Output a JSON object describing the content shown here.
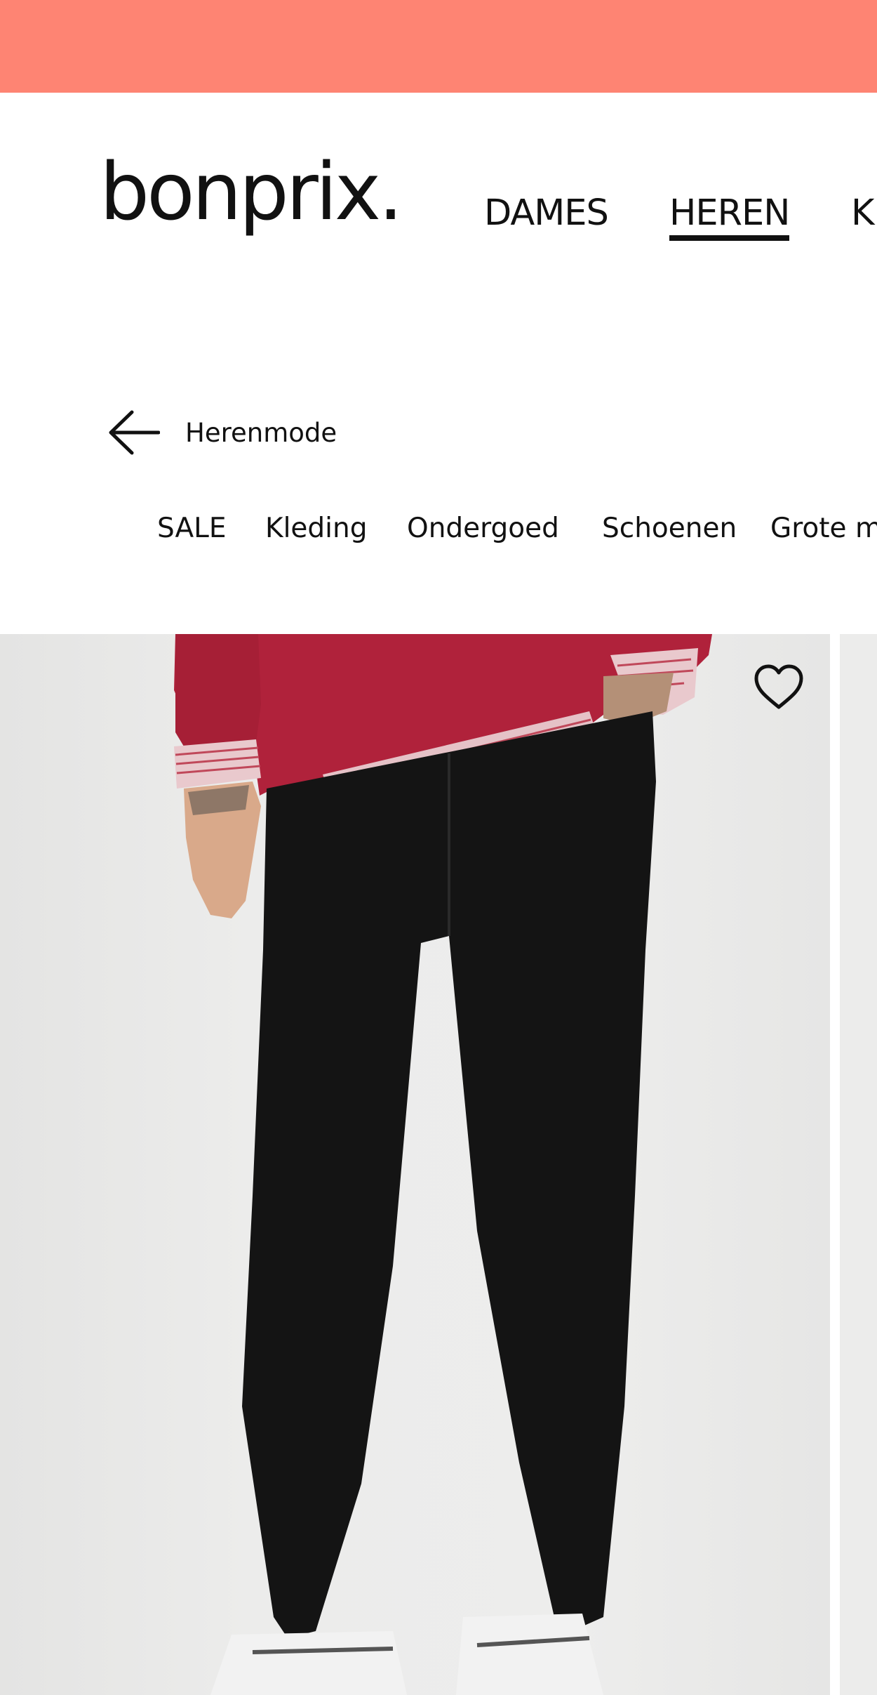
{
  "brand": {
    "logo_text": "bonprix.",
    "accent_color": "#fe8473"
  },
  "main_nav": {
    "items": [
      {
        "label": "DAMES",
        "active": false
      },
      {
        "label": "HEREN",
        "active": true
      },
      {
        "label": "K",
        "active": false
      }
    ]
  },
  "back_link": {
    "label": "Herenmode",
    "icon": "arrow-left-icon"
  },
  "sub_nav": {
    "items": [
      {
        "label": "SALE"
      },
      {
        "label": "Kleding"
      },
      {
        "label": "Ondergoed"
      },
      {
        "label": "Schoenen"
      },
      {
        "label": "Grote maten"
      }
    ]
  },
  "product": {
    "wishlist_icon": "heart-outline-icon",
    "sweater_color": "#b0223b",
    "trousers_color": "#141414"
  }
}
